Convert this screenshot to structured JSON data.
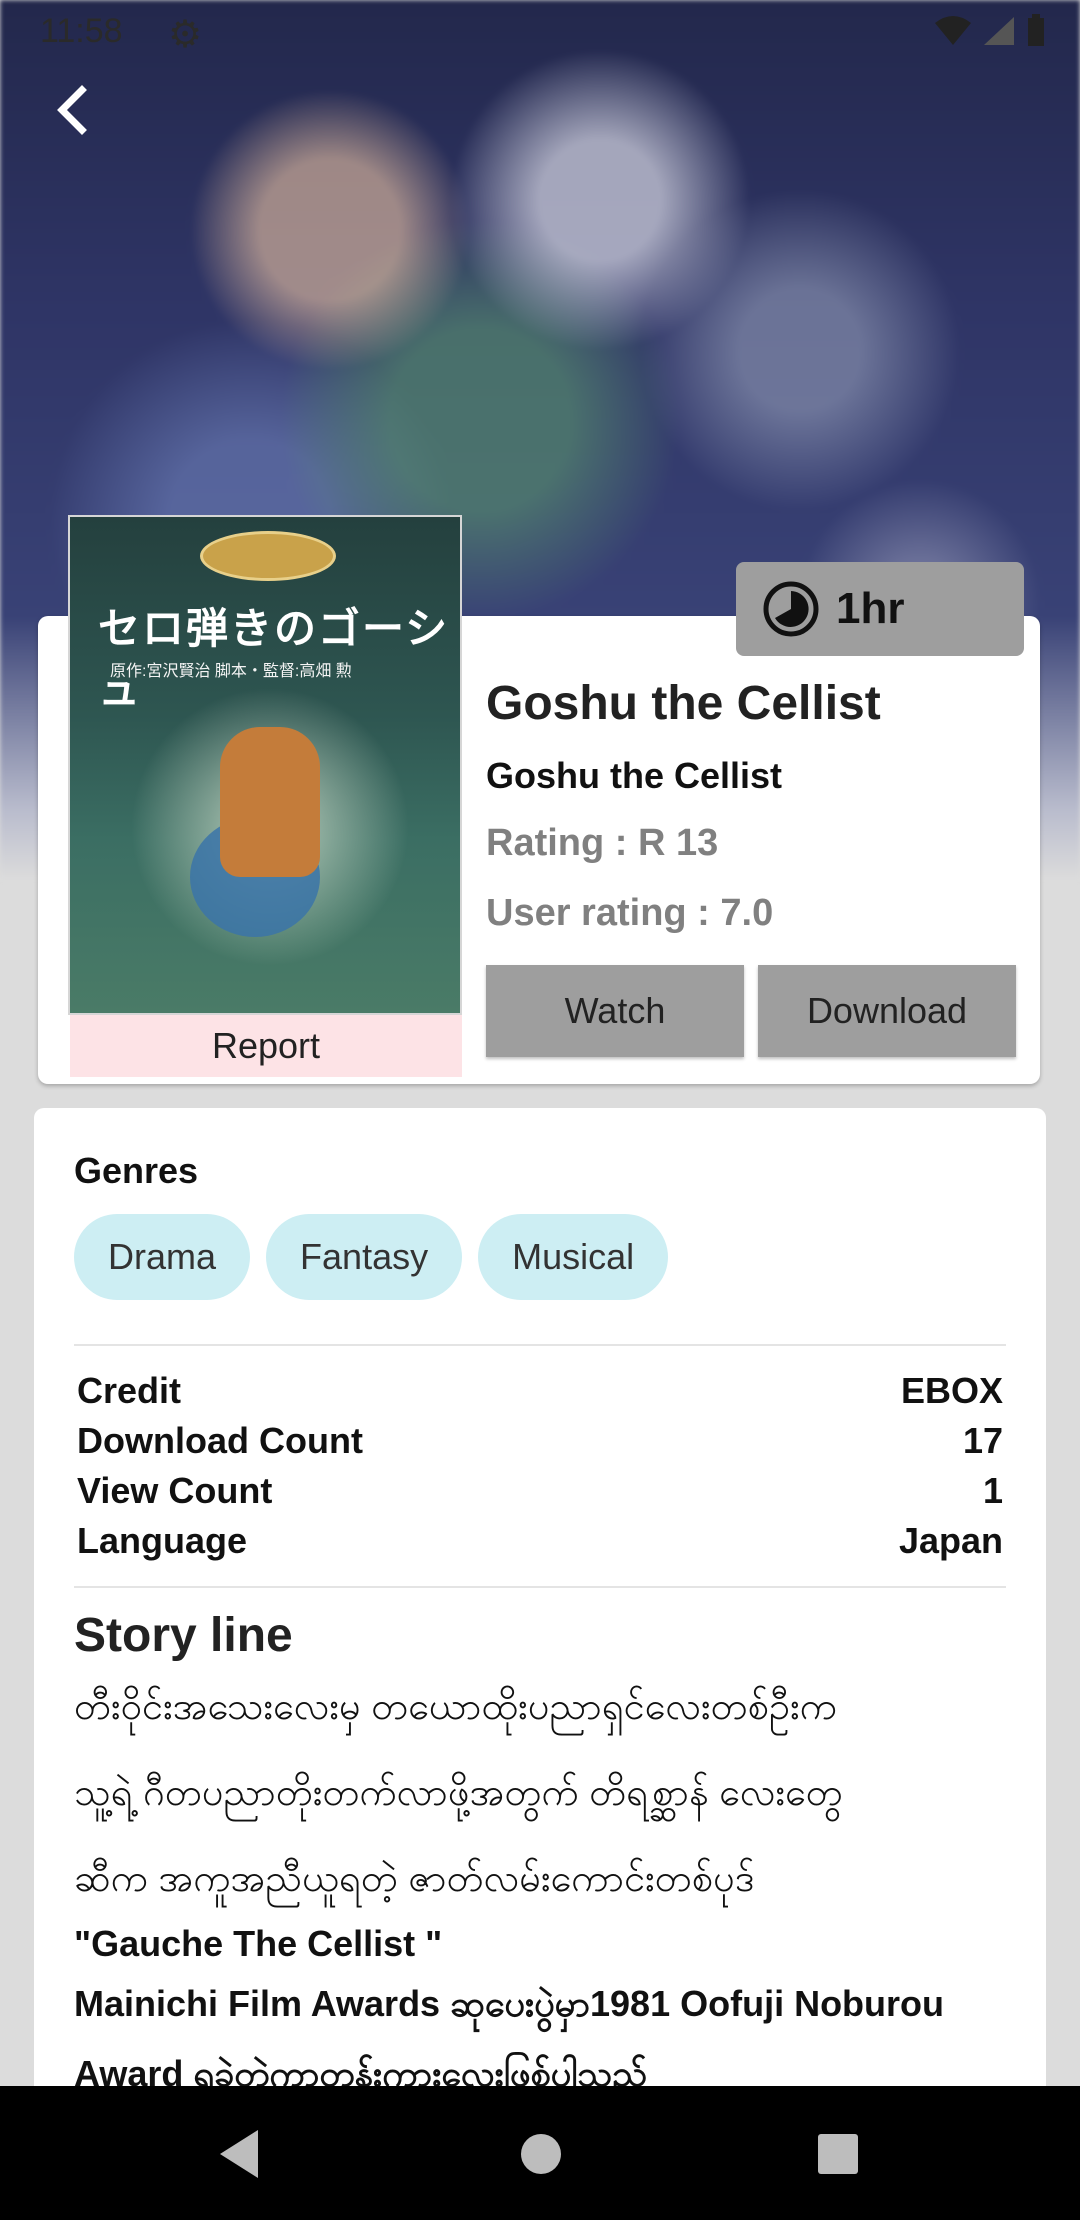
{
  "status_bar": {
    "time": "11:58",
    "icons": [
      "gear-icon",
      "wifi-icon",
      "signal-icon",
      "battery-icon"
    ]
  },
  "header": {
    "back_icon": "chevron-left-icon"
  },
  "movie": {
    "title": "Goshu the Cellist",
    "subtitle": "Goshu the Cellist",
    "rating": "Rating : R 13",
    "user_rating": "User rating : 7.0",
    "duration": "1hr",
    "poster": {
      "title_text": "セロ弾きのゴーシュ",
      "credits_text": "原作:宮沢賢治 脚本・監督:高畑 勲"
    },
    "report_label": "Report",
    "watch_label": "Watch",
    "download_label": "Download"
  },
  "details": {
    "genres_label": "Genres",
    "genres": [
      "Drama",
      "Fantasy",
      "Musical"
    ],
    "info_rows": [
      {
        "label": "Credit",
        "value": "EBOX"
      },
      {
        "label": "Download Count",
        "value": "17"
      },
      {
        "label": "View Count",
        "value": "1"
      },
      {
        "label": "Language",
        "value": "Japan"
      }
    ],
    "story_title": "Story line",
    "story_lines": [
      "တီးဝိုင်းအသေးလေးမှ တယောထိုးပညာရှင်လေးတစ်ဦးက",
      "သူ့ရဲ့ ဂီတပညာတိုးတက်လာဖို့အတွက် တိရစ္ဆာန် လေးတွေ",
      "ဆီက အကူအညီယူရတဲ့ ဇာတ်လမ်းကောင်းတစ်ပုဒ်"
    ],
    "story_en_1": "\"Gauche The Cellist \"",
    "story_en_2": "Mainichi Film Awards ဆုပေးပွဲမှာ1981 Oofuji Noburou",
    "story_en_3": "Award ရခဲ့တဲ့ကာတွန်းကားလေးဖြစ်ပါသည်"
  },
  "nav_bar": {
    "icons": [
      "back-triangle-icon",
      "home-circle-icon",
      "recents-square-icon"
    ]
  }
}
